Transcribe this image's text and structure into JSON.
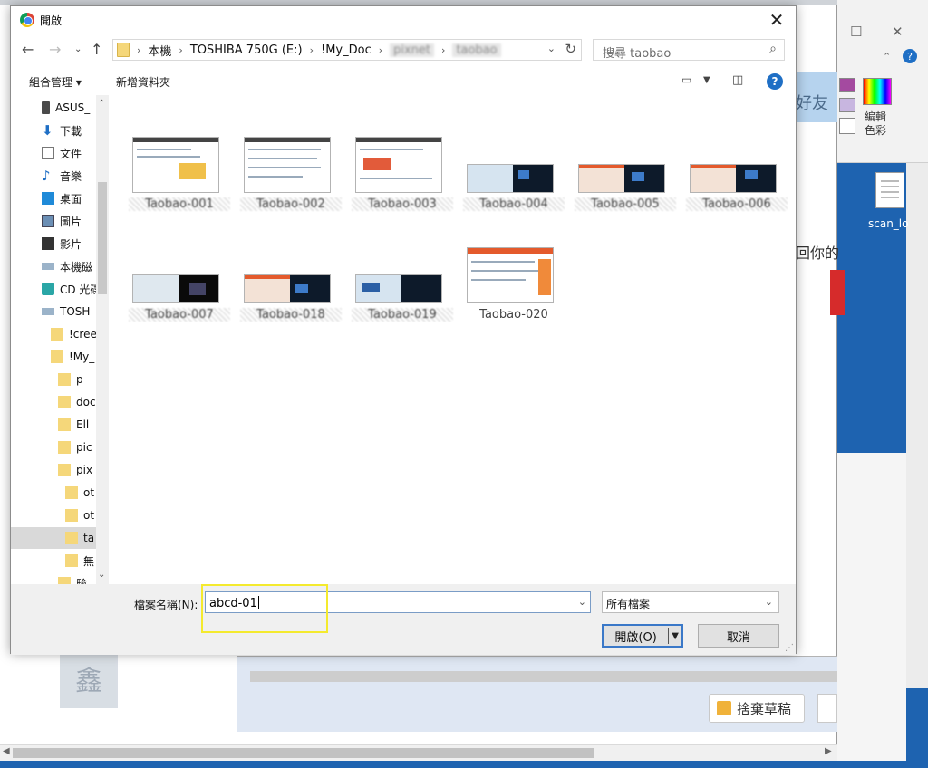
{
  "dialog": {
    "title": "開啟",
    "breadcrumb": [
      "本機",
      "TOSHIBA 750G (E:)",
      "!My_Doc",
      "pixnet",
      "taobao"
    ],
    "search_placeholder": "搜尋 taobao",
    "toolbar": {
      "organize": "組合管理 ▾",
      "new_folder": "新增資料夾"
    },
    "sidebar": [
      {
        "label": "ASUS_",
        "icon": "phone-icon"
      },
      {
        "label": "下載",
        "icon": "download-icon"
      },
      {
        "label": "文件",
        "icon": "document-icon"
      },
      {
        "label": "音樂",
        "icon": "music-icon"
      },
      {
        "label": "桌面",
        "icon": "desktop-icon"
      },
      {
        "label": "圖片",
        "icon": "pictures-icon"
      },
      {
        "label": "影片",
        "icon": "video-icon"
      },
      {
        "label": "本機磁",
        "icon": "drive-icon"
      },
      {
        "label": "CD 光碟",
        "icon": "cd-icon"
      },
      {
        "label": "TOSH",
        "icon": "drive-icon"
      },
      {
        "label": "!cree",
        "icon": "folder-icon"
      },
      {
        "label": "!My_",
        "icon": "folder-icon"
      },
      {
        "label": "p",
        "icon": "folder-icon"
      },
      {
        "label": "doc",
        "icon": "folder-icon"
      },
      {
        "label": "Ell",
        "icon": "folder-icon"
      },
      {
        "label": "pic",
        "icon": "folder-icon"
      },
      {
        "label": "pix",
        "icon": "folder-icon"
      },
      {
        "label": "ot",
        "icon": "folder-icon"
      },
      {
        "label": "ot",
        "icon": "folder-icon"
      },
      {
        "label": "ta",
        "icon": "folder-icon"
      },
      {
        "label": "無",
        "icon": "folder-icon"
      },
      {
        "label": "驗",
        "icon": "folder-icon"
      }
    ],
    "files": [
      {
        "name": "Taobao-001",
        "style": "a"
      },
      {
        "name": "Taobao-002",
        "style": "a"
      },
      {
        "name": "Taobao-003",
        "style": "a"
      },
      {
        "name": "Taobao-004",
        "style": "b"
      },
      {
        "name": "Taobao-005",
        "style": "b"
      },
      {
        "name": "Taobao-006",
        "style": "b"
      },
      {
        "name": "Taobao-007",
        "style": "b"
      },
      {
        "name": "Taobao-018",
        "style": "b"
      },
      {
        "name": "Taobao-019",
        "style": "b"
      },
      {
        "name": "Taobao-020",
        "style": "c"
      }
    ],
    "filename_label": "檔案名稱(N):",
    "filename_value": "abcd-01",
    "filetype_value": "所有檔案",
    "open_button": "開啟(O)",
    "cancel_button": "取消"
  },
  "background": {
    "edit_color_label": "編輯色彩",
    "file_label": "scan_lo",
    "side_text_1": "好友",
    "side_text_2": "回你的",
    "draft_button": "捨棄草稿"
  },
  "colors": {
    "accent": "#1f6fc5",
    "highlight": "#f4ea2e",
    "desktop_blue": "#1e63b0"
  }
}
